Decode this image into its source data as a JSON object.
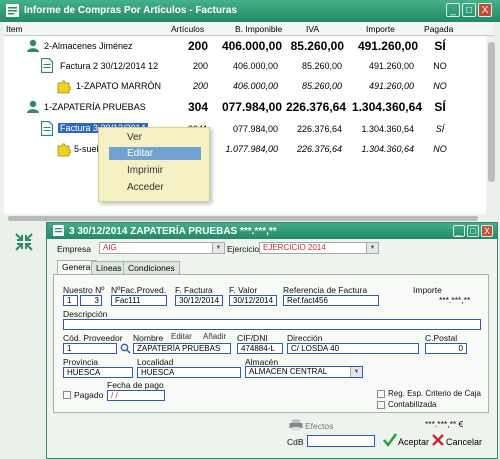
{
  "window": {
    "title": "Informe de Compras Por Artículos - Facturas",
    "min_label": "_",
    "max_label": "□",
    "close_label": "X"
  },
  "columns": [
    "Item",
    "Artículos",
    "B. Imponible",
    "IVA",
    "Importe",
    "Pagada"
  ],
  "rows": [
    {
      "label": "2-Almacenes Jiménez",
      "articulos": "200",
      "base": "406.000,00",
      "iva": "85.260,00",
      "importe": "491.260,00",
      "pagada": "SÍ"
    },
    {
      "label": "Factura 2 30/12/2014 12",
      "articulos": "200",
      "base": "406.000,00",
      "iva": "85.260,00",
      "importe": "491.260,00",
      "pagada": "NO"
    },
    {
      "label": "1-ZAPATO MARRÓN",
      "articulos": "200",
      "base": "406.000,00",
      "iva": "85.260,00",
      "importe": "491.260,00",
      "pagada": "NO"
    },
    {
      "label": "1-ZAPATERÍA PRUEBAS",
      "articulos": "304",
      "base": "077.984,00",
      "iva": "226.376,64",
      "importe": "1.304.360,64",
      "pagada": "SÍ"
    },
    {
      "label": "Factura 3 30/12/2014",
      "articulos": "3041",
      "base": "077.984,00",
      "iva": "226.376,64",
      "importe": "1.304.360,64",
      "pagada": "SÍ"
    },
    {
      "label": "5-suela",
      "articulos": "304",
      "base": "1.077.984,00",
      "iva": "226.376,64",
      "importe": "1.304.360,64",
      "pagada": "NO"
    }
  ],
  "context_menu": [
    "Ver",
    "Editar",
    "Imprimir",
    "Acceder"
  ],
  "dialog": {
    "title": "3 30/12/2014 ZAPATERÍA PRUEBAS  ***.***,**",
    "empresa_label": "Empresa",
    "empresa_value": "AIG",
    "ejercicio_label": "Ejercicio",
    "ejercicio_value": "EJERCICIO 2014",
    "tabs": [
      "General",
      "Líneas",
      "Condiciones"
    ],
    "nuestro_label": "Nuestro Nº",
    "nuestro_serie": "1",
    "nuestro_num": "3",
    "nfac_label": "NºFac.Proved.",
    "nfac_value": "Fac111",
    "ffactura_label": "F. Factura",
    "ffactura_value": "30/12/2014",
    "fvalor_label": "F. Valor",
    "fvalor_value": "30/12/2014",
    "ref_label": "Referencia de Factura",
    "ref_value": "Ref.fact456",
    "importe_label": "Importe",
    "importe_value": "***.***,**",
    "desc_label": "Descripción",
    "desc_value": "",
    "codprov_label": "Cód. Proveedor",
    "codprov_value": "1",
    "nombre_label": "Nombre",
    "editar_label": "Editar",
    "anadir_label": "Añadir",
    "nombre_value": "ZAPATERÍA PRUEBAS",
    "cif_label": "CIF/DNI",
    "cif_value": "474884-L",
    "dir_label": "Dirección",
    "dir_value": "C/ LOSDA 40",
    "cp_label": "C.Postal",
    "cp_value": "0",
    "prov_label": "Provincia",
    "prov_value": "HUESCA",
    "loc_label": "Localidad",
    "loc_value": "HUESCA",
    "alm_label": "Almacén",
    "alm_value": "ALMACEN CENTRAL",
    "fpago_label": "Fecha de pago",
    "fpago_value": "/ /",
    "pagado_label": "Pagado",
    "regesp_label": "Reg. Esp. Criterio de Caja",
    "contab_label": "Contabilizada",
    "efectos_label": "Efectos",
    "total_value": "***.***,** €",
    "cdb_label": "CdB",
    "cdb_value": "",
    "aceptar_label": "Aceptar",
    "cancelar_label": "Cancelar"
  },
  "colors": {
    "accent": "#2e9470",
    "field_border": "#2e5bb8",
    "selection": "#2d68c4",
    "menu_bg": "#f6f1c4"
  }
}
